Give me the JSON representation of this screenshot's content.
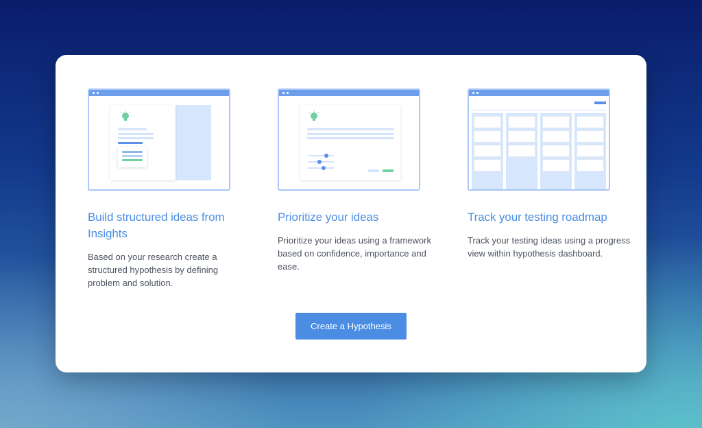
{
  "features": [
    {
      "title": "Build structured ideas from Insights",
      "description": "Based on your research create a structured hypothesis by defining problem and solution.",
      "illustration": "structured-idea-icon"
    },
    {
      "title": "Prioritize your ideas",
      "description": "Prioritize your ideas using a framework based on confidence, importance and ease.",
      "illustration": "prioritize-sliders-icon"
    },
    {
      "title": "Track your testing roadmap",
      "description": "Track your testing ideas using a progress view within hypothesis dashboard.",
      "illustration": "roadmap-board-icon"
    }
  ],
  "cta": {
    "label": "Create a Hypothesis"
  },
  "colors": {
    "accent": "#4a8de3",
    "title": "#4c8ee3",
    "illustration_border": "#a8c6f7",
    "illustration_fill": "#d5e6fd",
    "bulb_green": "#6fd0a0"
  }
}
